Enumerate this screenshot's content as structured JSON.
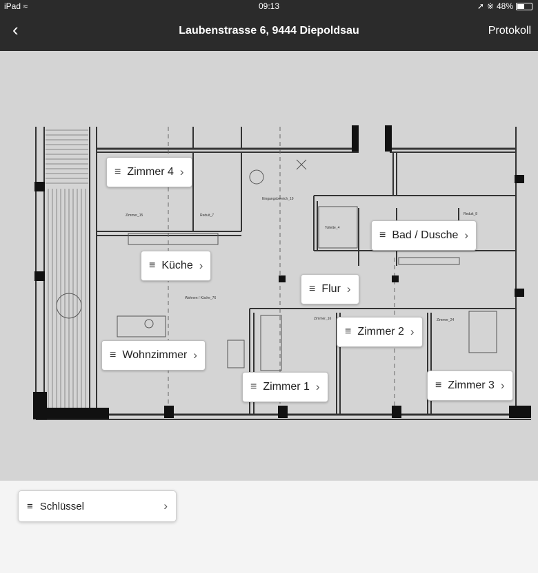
{
  "status": {
    "device": "iPad",
    "time": "09:13",
    "battery": "48%",
    "battery_level": 0.48
  },
  "nav": {
    "back_icon": "chevron-left-icon",
    "title": "Laubenstrasse 6, 9444 Diepoldsau",
    "action": "Protokoll"
  },
  "plan": {
    "texts": {
      "zimmer15": "Zimmer_15",
      "reduit": "Reduit_7",
      "eingang": "Eingangsbereich_19",
      "wohnen": "Wohnen / Küche_76",
      "zimmer16": "Zimmer_16",
      "zimmer24": "Zimmer_24",
      "toilette": "Toilette_4",
      "reduit8": "Reduit_8"
    },
    "rooms": [
      {
        "label": "Zimmer 4"
      },
      {
        "label": "Bad / Dusche"
      },
      {
        "label": "Küche"
      },
      {
        "label": "Flur"
      },
      {
        "label": "Zimmer 2"
      },
      {
        "label": "Wohnzimmer"
      },
      {
        "label": "Zimmer 1"
      },
      {
        "label": "Zimmer 3"
      }
    ]
  },
  "bottom": {
    "key_label": "Schlüssel"
  },
  "icons": {
    "menu": "hamburger-icon",
    "chevron": "chevron-right-icon",
    "wifi": "wifi-icon",
    "location": "location-icon",
    "bluetooth": "bluetooth-icon"
  }
}
